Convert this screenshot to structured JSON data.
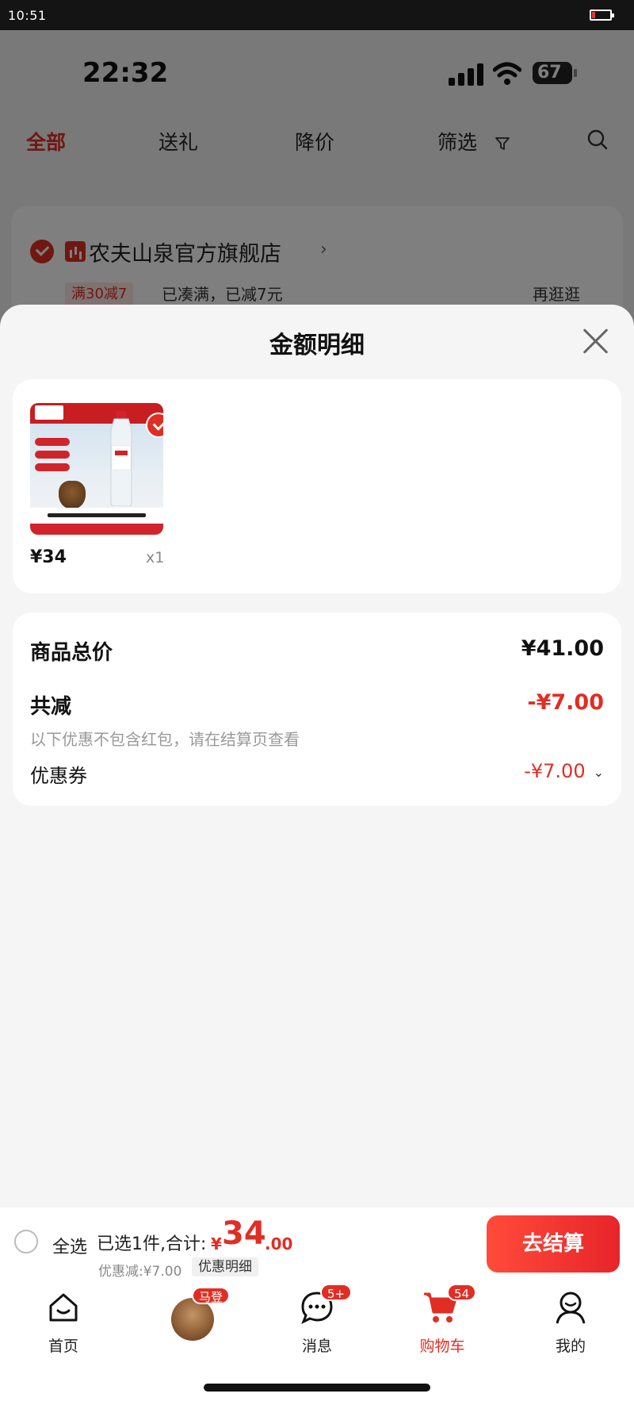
{
  "device": {
    "time": "10:51"
  },
  "phone": {
    "time": "22:32",
    "battery": "67"
  },
  "tabs": {
    "items": [
      "全部",
      "送礼",
      "降价",
      "筛选"
    ],
    "active": "全部"
  },
  "store": {
    "name": "农夫山泉官方旗舰店",
    "promo_tag": "满30减7",
    "promo_text": "已凑满，已减7元",
    "more_link": "再逛逛"
  },
  "sheet": {
    "title": "金额明细",
    "item": {
      "price": "¥34",
      "qty": "x1"
    },
    "summary": {
      "total_label": "商品总价",
      "total_value": "¥41.00",
      "reduce_label": "共减",
      "reduce_value": "-¥7.00",
      "reduce_note": "以下优惠不包含红包，请在结算页查看",
      "coupon_label": "优惠券",
      "coupon_value": "-¥7.00"
    }
  },
  "checkout": {
    "select_all": "全选",
    "selected_text": "已选1件,合计:",
    "currency": "¥",
    "total_int": "34",
    "total_dec": ".00",
    "discount_note": "优惠减:¥7.00",
    "detail_link": "优惠明细",
    "button": "去结算"
  },
  "nav": {
    "home": "首页",
    "avatar_badge": "马登",
    "messages": "消息",
    "messages_badge": "5+",
    "cart": "购物车",
    "cart_badge": "54",
    "me": "我的"
  },
  "colors": {
    "accent": "#e02e24",
    "sheet_bg": "#f5f5f5"
  },
  "icons": [
    "filter-icon",
    "search-icon",
    "close-icon",
    "home-icon",
    "message-icon",
    "cart-icon",
    "user-icon"
  ]
}
